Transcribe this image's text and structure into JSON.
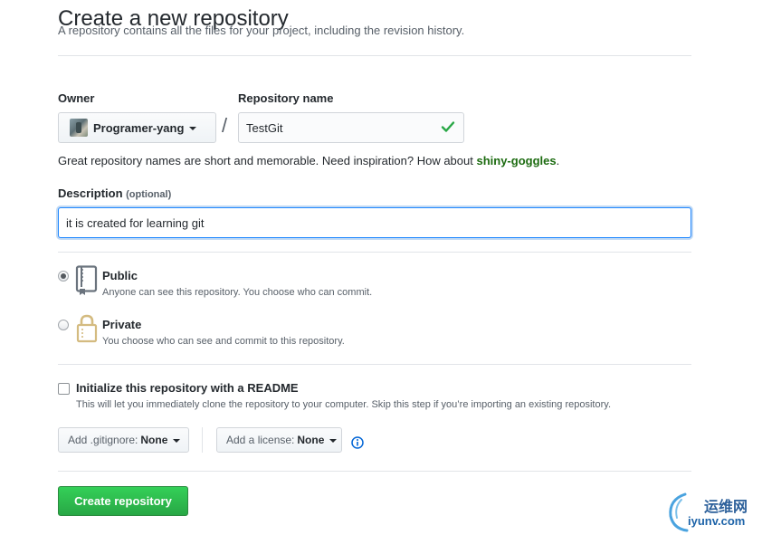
{
  "header": {
    "title": "Create a new repository",
    "subtitle": "A repository contains all the files for your project, including the revision history."
  },
  "owner": {
    "label": "Owner",
    "value": "Programer-yang"
  },
  "separator": "/",
  "repo_name": {
    "label": "Repository name",
    "value": "TestGit",
    "valid": true
  },
  "name_hint": {
    "text": "Great repository names are short and memorable. Need inspiration? How about ",
    "suggestion": "shiny-goggles",
    "end": "."
  },
  "description": {
    "label": "Description",
    "optional": "(optional)",
    "value": "it is created for learning git"
  },
  "visibility": {
    "selected": "public",
    "options": [
      {
        "id": "public",
        "title": "Public",
        "note": "Anyone can see this repository. You choose who can commit.",
        "icon": "repo-book-icon"
      },
      {
        "id": "private",
        "title": "Private",
        "note": "You choose who can see and commit to this repository.",
        "icon": "lock-icon"
      }
    ]
  },
  "readme": {
    "label": "Initialize this repository with a README",
    "note": "This will let you immediately clone the repository to your computer. Skip this step if you’re importing an existing repository.",
    "checked": false
  },
  "gitignore": {
    "label": "Add .gitignore:",
    "value": "None"
  },
  "license": {
    "label": "Add a license:",
    "value": "None"
  },
  "submit": {
    "label": "Create repository"
  },
  "watermark": {
    "cn": "运维网",
    "en": "iyunv.com"
  },
  "colors": {
    "primary_green": "#28a745",
    "suggestion_green": "#1c6b10",
    "focus_blue": "#2188ff",
    "info_blue": "#0366d6"
  }
}
